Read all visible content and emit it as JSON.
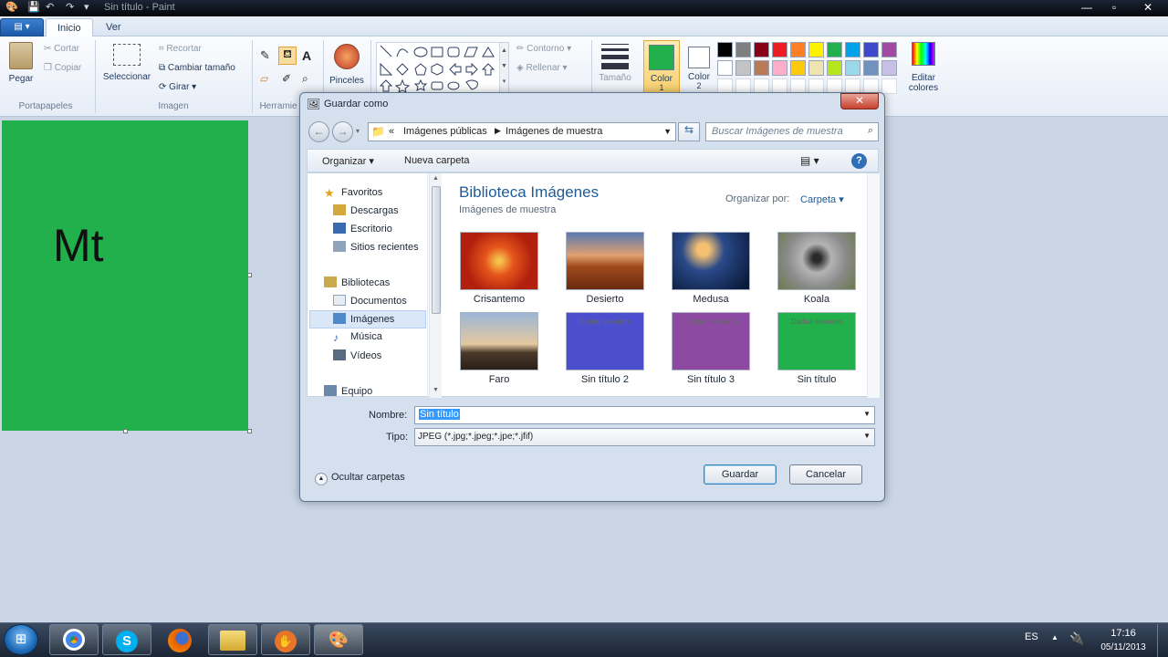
{
  "window": {
    "title": "Sin título - Paint",
    "controls": [
      "—",
      "▫",
      "✕"
    ]
  },
  "ribbon": {
    "tabs": [
      "Inicio",
      "Ver"
    ],
    "portapapeles": {
      "label": "Portapapeles",
      "paste": "Pegar",
      "cut": "Cortar",
      "copy": "Copiar"
    },
    "imagen": {
      "label": "Imagen",
      "select": "Seleccionar",
      "crop": "Recortar",
      "resize": "Cambiar tamaño",
      "rotate": "Girar"
    },
    "herramientas": {
      "label": "Herramie"
    },
    "brushes": "Pinceles",
    "formas": {
      "outline": "Contorno",
      "fill": "Rellenar"
    },
    "size": "Tamaño",
    "color1": {
      "label": "Color",
      "num": "1",
      "value": "#22b04c"
    },
    "color2": {
      "label": "Color",
      "num": "2",
      "value": "#ffffff"
    },
    "edit_colors": [
      "Editar",
      "colores"
    ],
    "palette_row1": [
      "#000000",
      "#7f7f7f",
      "#880015",
      "#ed1c24",
      "#ff7f27",
      "#fff200",
      "#22b14c",
      "#00a2e8",
      "#3f48cc",
      "#a349a4"
    ],
    "palette_row2": [
      "#ffffff",
      "#c3c3c3",
      "#b97a57",
      "#ffaec9",
      "#ffc90e",
      "#efe4b0",
      "#b5e61d",
      "#99d9ea",
      "#7092be",
      "#c8bfe7"
    ]
  },
  "canvas": {
    "text": "Mt",
    "color": "#22b04c"
  },
  "dialog": {
    "title": "Guardar como",
    "breadcrumb": [
      "Imágenes públicas",
      "Imágenes de muestra"
    ],
    "search_placeholder": "Buscar Imágenes de muestra",
    "toolbar": {
      "organize": "Organizar",
      "new_folder": "Nueva carpeta"
    },
    "nav": {
      "favorites": "Favoritos",
      "fav_items": [
        "Descargas",
        "Escritorio",
        "Sitios recientes"
      ],
      "libraries": "Bibliotecas",
      "lib_items": [
        "Documentos",
        "Imágenes",
        "Música",
        "Vídeos"
      ],
      "computer": "Equipo"
    },
    "library": {
      "title": "Biblioteca Imágenes",
      "subtitle": "Imágenes de muestra",
      "arrange_by": "Organizar por:",
      "arrange_value": "Carpeta"
    },
    "files": [
      {
        "name": "Crisantemo",
        "overlay": ""
      },
      {
        "name": "Desierto",
        "overlay": ""
      },
      {
        "name": "Medusa",
        "overlay": ""
      },
      {
        "name": "Koala",
        "overlay": ""
      },
      {
        "name": "Faro",
        "overlay": ""
      },
      {
        "name": "Sin título 2",
        "overlay": "Dadad sesaerm"
      },
      {
        "name": "Sin título 3",
        "overlay": "Dadad sesaerm"
      },
      {
        "name": "Sin título",
        "overlay": "Dadad sesaerm"
      }
    ],
    "name_label": "Nombre:",
    "name_value": "Sin título",
    "type_label": "Tipo:",
    "type_value": "JPEG (*.jpg;*.jpeg;*.jpe;*.jfif)",
    "hide_folders": "Ocultar carpetas",
    "save": "Guardar",
    "cancel": "Cancelar"
  },
  "taskbar": {
    "lang": "ES",
    "time": "17:16",
    "date": "05/11/2013"
  }
}
